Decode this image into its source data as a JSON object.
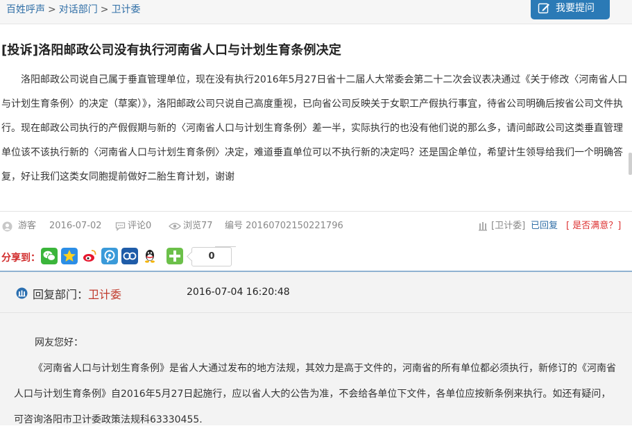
{
  "breadcrumb": {
    "items": [
      "百姓呼声",
      "对话部门",
      "卫计委"
    ],
    "separator": ">"
  },
  "ask_button": {
    "label": "我要提问"
  },
  "question": {
    "title": "[投诉]洛阳邮政公司没有执行河南省人口与计划生育条例决定",
    "body": "洛阳邮政公司说自己属于垂直管理单位，现在没有执行2016年5月27日省十二届人大常委会第二十二次会议表决通过《关于修改〈河南省人口与计划生育条例〉的决定（草案）》，洛阳邮政公司只说自己高度重视，已向省公司反映关于女职工产假执行事宜，待省公司明确后按省公司文件执行。现在邮政公司执行的产假假期与新的〈河南省人口与计划生育条例〉差一半，实际执行的也没有他们说的那么多，请问邮政公司这类垂直管理单位该不该执行新的〈河南省人口与计划生育条例〉决定，难道垂直单位可以不执行新的决定吗？还是国企单位，希望计生领导给我们一个明确答复，好让我们这类女同胞提前做好二胎生育计划，谢谢"
  },
  "meta": {
    "user": "游客",
    "date": "2016-07-02",
    "comments": "评论0",
    "views": "浏览77",
    "number": "编号 20160702150221796",
    "department": "[卫计委]",
    "status": "已回复",
    "satisfaction": "[ 是否满意？]"
  },
  "share": {
    "label": "分享到：",
    "count": "0",
    "icons": [
      "wechat-icon",
      "qzone-icon",
      "weibo-icon",
      "tencent-weibo-icon",
      "renren-icon",
      "qq-icon",
      "more-share-icon"
    ]
  },
  "reply": {
    "dept_label": "回复部门：",
    "dept_name": "卫计委",
    "time": "2016-07-04 16:20:48",
    "greeting": "网友您好：",
    "body": "《河南省人口与计划生育条例》是省人大通过发布的地方法规，其效力是高于文件的，河南省的所有单位都必须执行，新修订的《河南省人口与计划生育条例》自2016年5月27日起施行，应以省人大的公告为准，不会给各单位下文件，各单位应按新条例来执行。如还有疑问，可咨询洛阳市卫计委政策法规科63330455."
  },
  "colors": {
    "link": "#2f6ea6",
    "button": "#2b7ab6",
    "share_label": "#d12c2c",
    "dept_name": "#c0392b"
  }
}
